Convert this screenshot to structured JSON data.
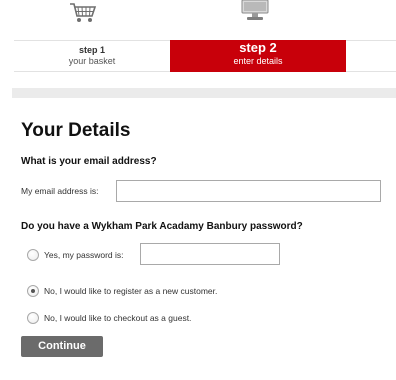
{
  "steps": [
    {
      "title": "step 1",
      "subtitle": "your basket"
    },
    {
      "title": "step 2",
      "subtitle": "enter details"
    }
  ],
  "icons": {
    "step1": "basket-icon",
    "step2": "monitor-icon"
  },
  "colors": {
    "active_step": "#c8000a",
    "continue_button": "#6b6b6b",
    "band": "#ebebeb"
  },
  "page_title": "Your Details",
  "email": {
    "question": "What is your email address?",
    "label": "My email address is:",
    "value": ""
  },
  "password": {
    "question": "Do you have a Wykham Park Acadamy Banbury password?",
    "value": ""
  },
  "options": [
    {
      "label": "Yes, my password is:",
      "checked": false
    },
    {
      "label": "No, I would like to register as a new customer.",
      "checked": true
    },
    {
      "label": "No, I would like to checkout as a guest.",
      "checked": false
    }
  ],
  "continue_label": "Continue"
}
